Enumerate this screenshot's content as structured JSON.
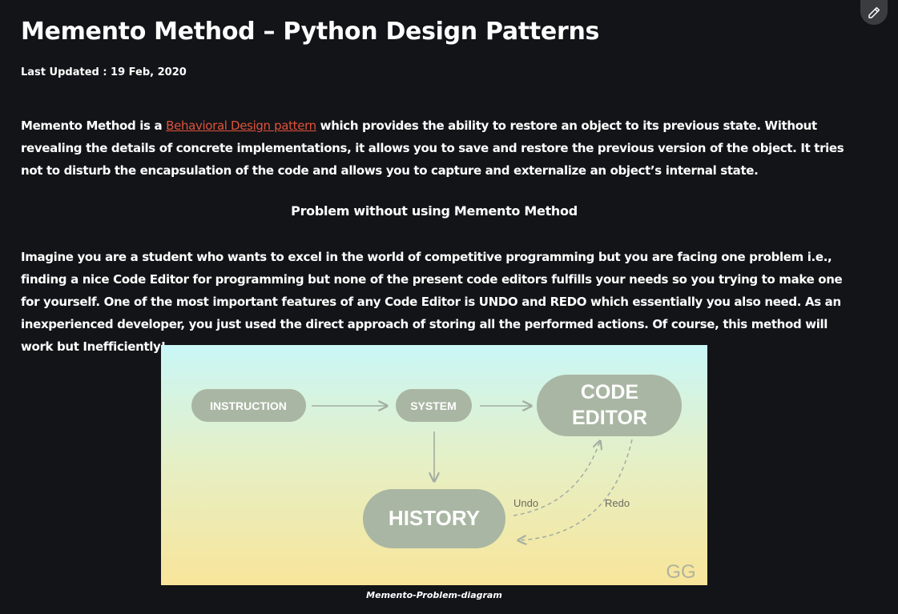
{
  "article": {
    "title": "Memento Method – Python Design Patterns",
    "last_updated": "Last Updated : 19 Feb, 2020",
    "intro": {
      "before_link": "Memento Method is a ",
      "link_text": "Behavioral Design pattern",
      "after_link": " which provides the ability to restore an object to its previous state. Without revealing the details of concrete implementations, it allows you to save and restore the previous version of the object. It tries not to disturb the encapsulation of the code and allows you to capture and externalize an object’s internal state."
    },
    "section_heading": "Problem without using Memento Method",
    "problem": {
      "part1": "Imagine you are a student who wants to excel in the world of competitive programming but you are facing one problem i.e., finding a nice ",
      "bold1": "Code Editor",
      "part2": " for programming but none of the present code editors fulfills your needs so you trying to make one for yourself. One of the most important features of any Code Editor is ",
      "bold2": "UNDO",
      "part3": " and ",
      "bold3": "REDO",
      "part4": " which essentially you also need. As an inexperienced developer, you just used the direct approach of storing all the performed actions. Of course, this method will work but Inefficiently!"
    },
    "figure": {
      "nodes": {
        "instruction": "INSTRUCTION",
        "system": "SYSTEM",
        "code_editor_line1": "CODE",
        "code_editor_line2": "EDITOR",
        "history": "HISTORY"
      },
      "undo_label": "Undo",
      "redo_label": "Redo",
      "watermark": "GG",
      "caption": "Memento-Problem-diagram"
    }
  },
  "toolbar": {
    "edit_icon": "pencil-icon"
  },
  "colors": {
    "page_background": "#131417",
    "link": "#e0523c",
    "node_fill": "#a9b6a3",
    "figure_gradient_top": "#c9f7f7",
    "figure_gradient_bottom": "#f8e59a"
  }
}
